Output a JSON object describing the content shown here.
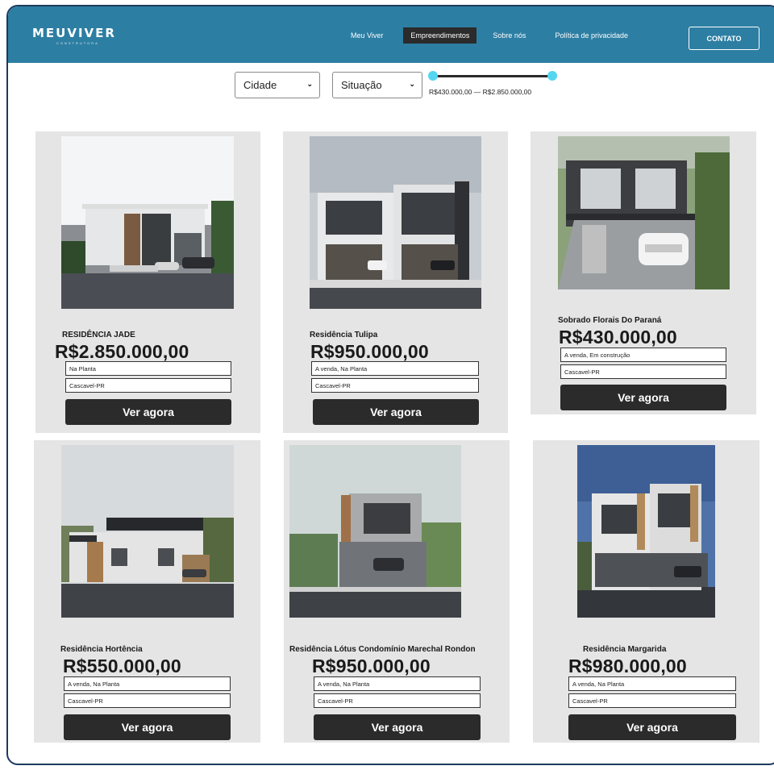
{
  "header": {
    "logo_text": "MEUVIVER",
    "logo_subtext": "CONSTRUTORA",
    "nav": [
      "Meu Viver",
      "Empreendimentos",
      "Sobre nós",
      "Política de privacidade"
    ],
    "active_nav": "Empreendimentos",
    "contact_label": "CONTATO"
  },
  "filters": {
    "city_selected": "Cidade",
    "status_selected": "Situação",
    "price_range_label": "R$430.000,00 — R$2.850.000,00",
    "price_min": 430000,
    "price_max": 2850000
  },
  "cta_label": "Ver agora",
  "listings": [
    {
      "title": "RESIDÊNCIA JADE",
      "price": "R$2.850.000,00",
      "status": "Na Planta",
      "location": "Cascavel-PR"
    },
    {
      "title": "Residência Tulipa",
      "price": "R$950.000,00",
      "status": "A venda,  Na Planta",
      "location": "Cascavel-PR"
    },
    {
      "title": "Sobrado Florais Do Paraná",
      "price": "R$430.000,00",
      "status": "A venda,  Em construção",
      "location": "Cascavel-PR"
    },
    {
      "title": "Residência Hortência",
      "price": "R$550.000,00",
      "status": "A venda,  Na Planta",
      "location": "Cascavel-PR"
    },
    {
      "title": "Residência Lótus Condomínio Marechal Rondon",
      "price": "R$950.000,00",
      "status": "A venda,  Na Planta",
      "location": "Cascavel-PR"
    },
    {
      "title": "Residência Margarida",
      "price": "R$980.000,00",
      "status": "A venda,  Na Planta",
      "location": "Cascavel-PR"
    }
  ],
  "colors": {
    "header_bg": "#2d7ea3",
    "card_bg": "#e5e5e5",
    "button_bg": "#2b2b2b",
    "slider_knob": "#53d6f0"
  }
}
